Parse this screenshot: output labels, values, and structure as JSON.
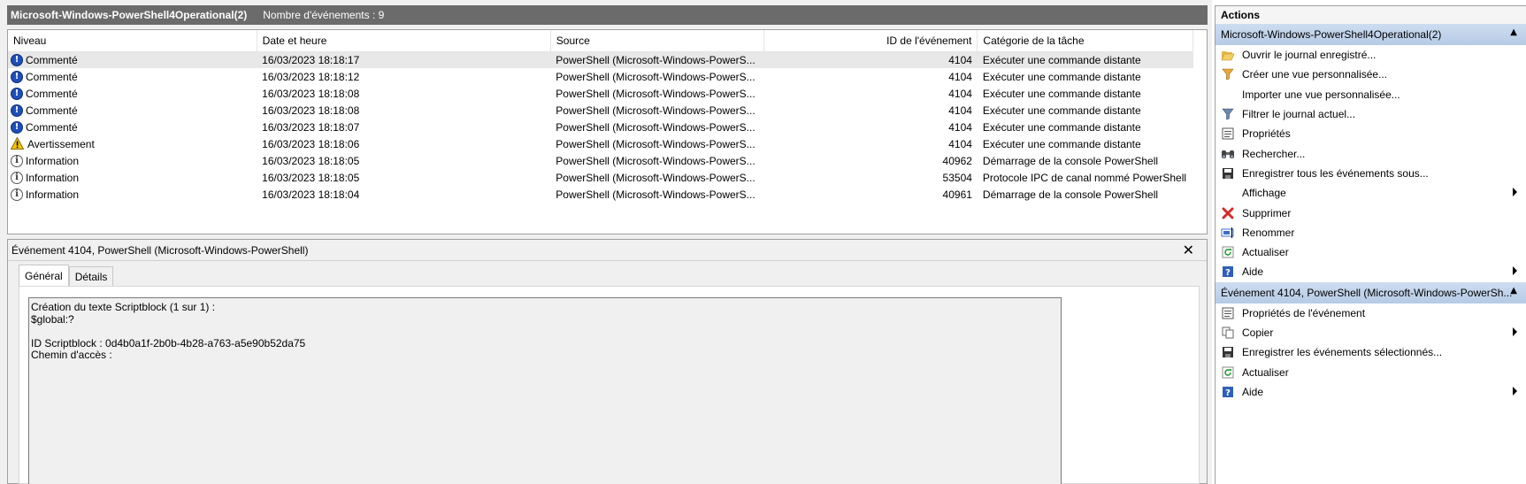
{
  "header": {
    "log_name": "Microsoft-Windows-PowerShell4Operational(2)",
    "event_count": "Nombre d'événements : 9"
  },
  "columns": [
    "Niveau",
    "Date et heure",
    "Source",
    "ID de l'événement",
    "Catégorie de la tâche"
  ],
  "events": [
    {
      "level": "Commenté",
      "icon": "info-icon",
      "date": "16/03/2023 18:18:17",
      "source": "PowerShell (Microsoft-Windows-PowerS...",
      "id": "4104",
      "category": "Exécuter une commande distante"
    },
    {
      "level": "Commenté",
      "icon": "info-icon",
      "date": "16/03/2023 18:18:12",
      "source": "PowerShell (Microsoft-Windows-PowerS...",
      "id": "4104",
      "category": "Exécuter une commande distante"
    },
    {
      "level": "Commenté",
      "icon": "info-icon",
      "date": "16/03/2023 18:18:08",
      "source": "PowerShell (Microsoft-Windows-PowerS...",
      "id": "4104",
      "category": "Exécuter une commande distante"
    },
    {
      "level": "Commenté",
      "icon": "info-icon",
      "date": "16/03/2023 18:18:08",
      "source": "PowerShell (Microsoft-Windows-PowerS...",
      "id": "4104",
      "category": "Exécuter une commande distante"
    },
    {
      "level": "Commenté",
      "icon": "info-icon",
      "date": "16/03/2023 18:18:07",
      "source": "PowerShell (Microsoft-Windows-PowerS...",
      "id": "4104",
      "category": "Exécuter une commande distante"
    },
    {
      "level": "Avertissement",
      "icon": "warning-icon",
      "date": "16/03/2023 18:18:06",
      "source": "PowerShell (Microsoft-Windows-PowerS...",
      "id": "4104",
      "category": "Exécuter une commande distante"
    },
    {
      "level": "Information",
      "icon": "information-outline-icon",
      "date": "16/03/2023 18:18:05",
      "source": "PowerShell (Microsoft-Windows-PowerS...",
      "id": "40962",
      "category": "Démarrage de la console PowerShell"
    },
    {
      "level": "Information",
      "icon": "information-outline-icon",
      "date": "16/03/2023 18:18:05",
      "source": "PowerShell (Microsoft-Windows-PowerS...",
      "id": "53504",
      "category": "Protocole IPC de canal nommé PowerShell"
    },
    {
      "level": "Information",
      "icon": "information-outline-icon",
      "date": "16/03/2023 18:18:04",
      "source": "PowerShell (Microsoft-Windows-PowerS...",
      "id": "40961",
      "category": "Démarrage de la console PowerShell"
    }
  ],
  "detail": {
    "title": "Événement 4104, PowerShell (Microsoft-Windows-PowerShell)",
    "close": "✕",
    "tabs": [
      "Général",
      "Détails"
    ],
    "text": "Création du texte Scriptblock (1 sur 1) :\n$global:?\n\nID Scriptblock : 0d4b0a1f-2b0b-4b28-a763-a5e90b52da75\nChemin d'accès :"
  },
  "actions": {
    "title": "Actions",
    "section1": {
      "label": "Microsoft-Windows-PowerShell4Operational(2)",
      "items": [
        {
          "label": "Ouvrir le journal enregistré...",
          "icon": "open-folder-icon"
        },
        {
          "label": "Créer une vue personnalisée...",
          "icon": "funnel-icon"
        },
        {
          "label": "Importer une vue personnalisée...",
          "icon": ""
        },
        {
          "label": "Filtrer le journal actuel...",
          "icon": "filter-icon"
        },
        {
          "label": "Propriétés",
          "icon": "properties-icon"
        },
        {
          "label": "Rechercher...",
          "icon": "binoculars-icon"
        },
        {
          "label": "Enregistrer tous les événements sous...",
          "icon": "save-icon"
        },
        {
          "label": "Affichage",
          "icon": ""
        },
        {
          "label": "Supprimer",
          "icon": "delete-icon"
        },
        {
          "label": "Renommer",
          "icon": "rename-icon"
        },
        {
          "label": "Actualiser",
          "icon": "refresh-icon"
        },
        {
          "label": "Aide",
          "icon": "help-icon"
        }
      ]
    },
    "section2": {
      "label": "Événement 4104, PowerShell (Microsoft-Windows-PowerSh...",
      "items": [
        {
          "label": "Propriétés de l'événement",
          "icon": "event-properties-icon"
        },
        {
          "label": "Copier",
          "icon": "copy-icon"
        },
        {
          "label": "Enregistrer les événements sélectionnés...",
          "icon": "save-icon"
        },
        {
          "label": "Actualiser",
          "icon": "refresh-icon"
        },
        {
          "label": "Aide",
          "icon": "help-icon"
        }
      ]
    }
  },
  "colors": {
    "title_bar": "#6b6b6b",
    "section_header": "#c3d4ec",
    "info_icon": "#1f4fb5",
    "warning_icon": "#f5c400",
    "delete_icon": "#d22a2a"
  }
}
